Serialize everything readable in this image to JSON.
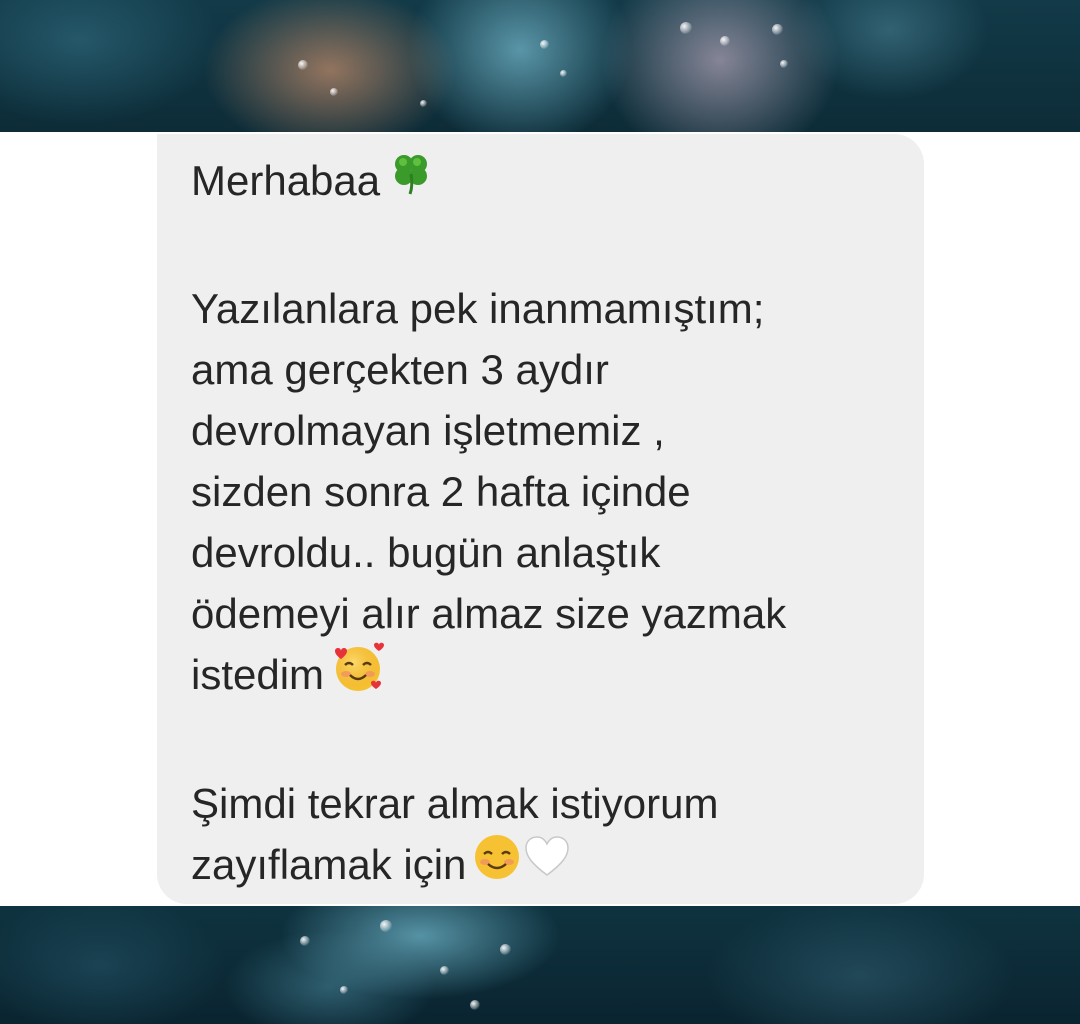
{
  "message": {
    "greeting": "Merhabaa",
    "greeting_emoji": "four-leaf-clover-icon",
    "paragraph_1": [
      "Yazılanlara pek inanmamıştım;",
      "ama gerçekten 3 aydır",
      "devrolmayan işletmemiz ,",
      "sizden sonra 2 hafta içinde",
      "devroldu.. bugün anlaştık",
      "ödemeyi alır almaz size yazmak",
      "istedim"
    ],
    "paragraph_1_emoji": "smiling-face-with-hearts-icon",
    "paragraph_2": [
      "Şimdi tekrar almak istiyorum",
      "zayıflamak için"
    ],
    "paragraph_2_emojis": [
      "smiling-face-icon",
      "white-heart-icon"
    ]
  },
  "colors": {
    "bubble": "#efefef",
    "text": "#262626",
    "band": "#ffffff"
  }
}
